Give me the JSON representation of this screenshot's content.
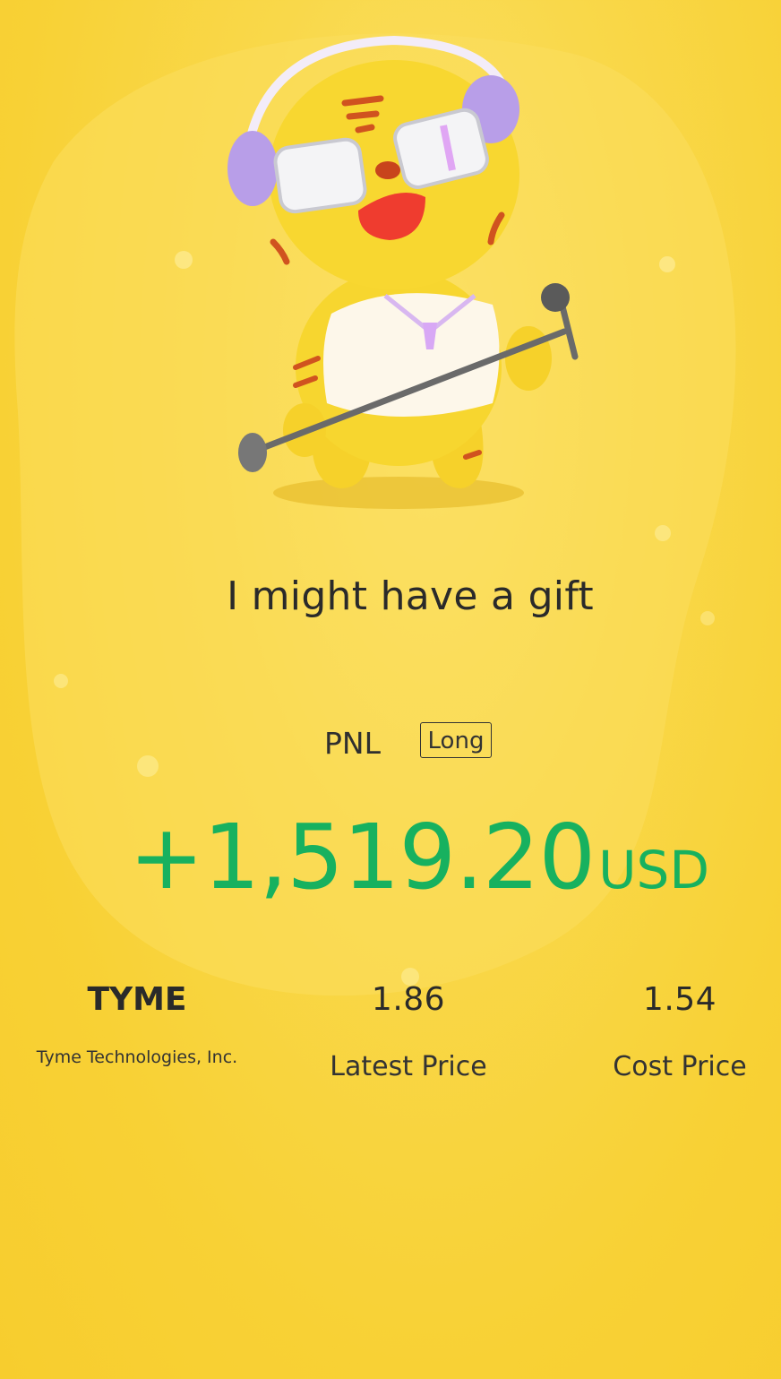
{
  "headline": "I might have a gift",
  "pnl": {
    "label": "PNL",
    "direction_tag": "Long",
    "amount": "+1,519.20",
    "currency": "USD",
    "color": "#17b15f"
  },
  "stock": {
    "ticker": "TYME",
    "name": "Tyme Technologies, Inc."
  },
  "latest_price": {
    "value": "1.86",
    "label": "Latest Price"
  },
  "cost_price": {
    "value": "1.54",
    "label": "Cost Price"
  },
  "mascot": {
    "icon": "tiger-mascot-with-headphones-and-microphone-icon"
  },
  "colors": {
    "background": "#f8d135",
    "text": "#2a2a2a"
  }
}
